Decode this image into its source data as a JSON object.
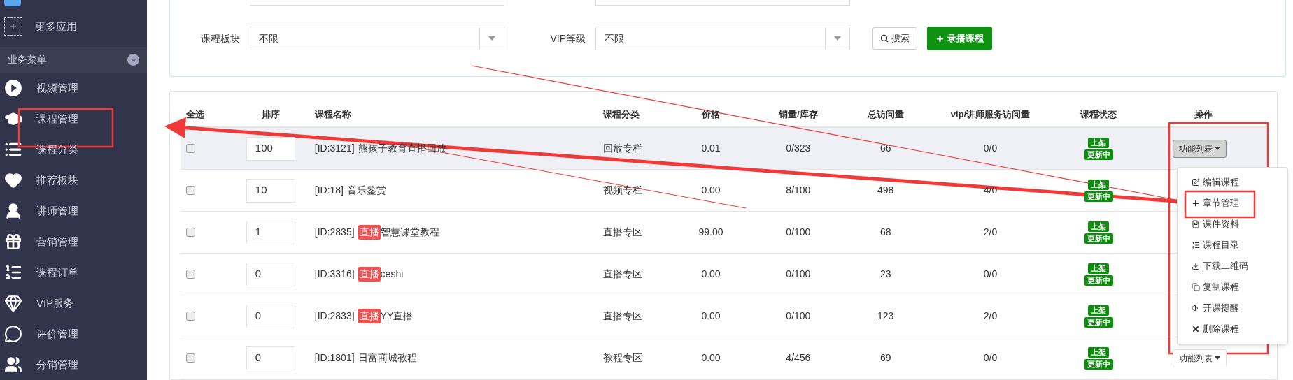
{
  "sidebar": {
    "more_apps": "更多应用",
    "section": {
      "label": "业务菜单",
      "expanded": true
    },
    "items": [
      {
        "label": "视频管理"
      },
      {
        "label": "课程管理"
      },
      {
        "label": "课程分类"
      },
      {
        "label": "推荐板块"
      },
      {
        "label": "讲师管理"
      },
      {
        "label": "营销管理"
      },
      {
        "label": "课程订单"
      },
      {
        "label": "VIP服务"
      },
      {
        "label": "评价管理"
      },
      {
        "label": "分销管理"
      }
    ]
  },
  "filters": [
    {
      "label": "课程板块",
      "value": "不限"
    },
    {
      "label": "VIP等级",
      "value": "不限"
    }
  ],
  "search_button": "搜索",
  "add_button": "录播课程",
  "table": {
    "columns": [
      "全选",
      "排序",
      "课程名称",
      "课程分类",
      "价格",
      "销量/库存",
      "总访问量",
      "vip/讲师服务访问量",
      "课程状态",
      "操作"
    ],
    "rows": [
      {
        "checked": false,
        "highlighted": true,
        "sort": "100",
        "id": "[ID:3121]",
        "tag": null,
        "title": "熊孩子教育直播回放",
        "category": "回放专栏",
        "price": "0.01",
        "sales": "0/323",
        "visits": "66",
        "vip_visits": "0/0",
        "status": [
          "上架",
          "更新中"
        ],
        "action": {
          "label": "功能列表",
          "active": true
        }
      },
      {
        "checked": false,
        "highlighted": false,
        "sort": "10",
        "id": "[ID:18]",
        "tag": null,
        "title": "音乐鉴赏",
        "category": "视频专栏",
        "price": "0.00",
        "sales": "8/100",
        "visits": "498",
        "vip_visits": "4/0",
        "status": [
          "上架",
          "更新中"
        ],
        "action": null
      },
      {
        "checked": false,
        "highlighted": false,
        "sort": "1",
        "id": "[ID:2835]",
        "tag": "直播",
        "title": "智慧课堂教程",
        "category": "直播专区",
        "price": "99.00",
        "sales": "0/100",
        "visits": "68",
        "vip_visits": "2/0",
        "status": [
          "上架",
          "更新中"
        ],
        "action": null
      },
      {
        "checked": false,
        "highlighted": false,
        "sort": "0",
        "id": "[ID:3316]",
        "tag": "直播",
        "title": "ceshi",
        "category": "直播专区",
        "price": "0.00",
        "sales": "0/100",
        "visits": "23",
        "vip_visits": "0/0",
        "status": [
          "上架",
          "更新中"
        ],
        "action": null
      },
      {
        "checked": false,
        "highlighted": false,
        "sort": "0",
        "id": "[ID:2833]",
        "tag": "直播",
        "title": "YY直播",
        "category": "直播专区",
        "price": "0.00",
        "sales": "0/100",
        "visits": "123",
        "vip_visits": "2/0",
        "status": [
          "上架",
          "更新中"
        ],
        "action": null
      },
      {
        "checked": false,
        "highlighted": false,
        "sort": "0",
        "id": "[ID:1801]",
        "tag": null,
        "title": "日富商城教程",
        "category": "教程专区",
        "price": "0.00",
        "sales": "4/456",
        "visits": "69",
        "vip_visits": "0/0",
        "status": [
          "上架",
          "更新中"
        ],
        "action": {
          "label": "功能列表",
          "active": false
        }
      }
    ]
  },
  "action_menu": {
    "open": true,
    "items": [
      "编辑课程",
      "章节管理",
      "课件资料",
      "课程目录",
      "下载二维码",
      "复制课程",
      "开课提醒",
      "删除课程"
    ]
  }
}
